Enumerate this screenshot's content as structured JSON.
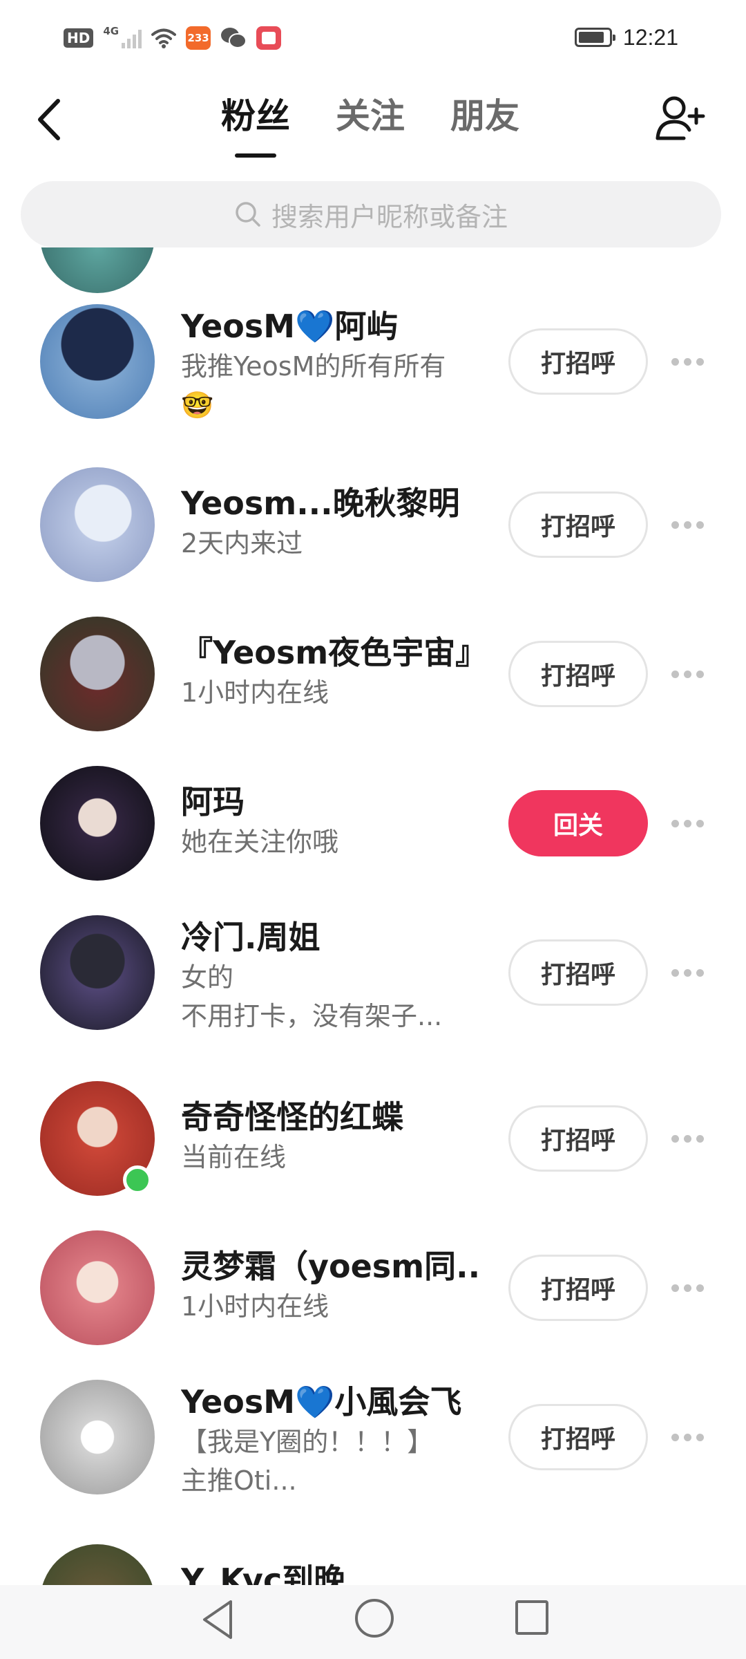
{
  "status_bar": {
    "hd": "HD",
    "network": "4G",
    "app_badge": "233",
    "time": "12:21"
  },
  "header": {
    "tabs": [
      {
        "label": "粉丝",
        "active": true
      },
      {
        "label": "关注",
        "active": false
      },
      {
        "label": "朋友",
        "active": false
      }
    ]
  },
  "search": {
    "placeholder": "搜索用户昵称或备注"
  },
  "contacts": [
    {
      "name": "YeosM💙阿屿",
      "sub": "我推YeosM的所有所有",
      "sub2": "🤓",
      "button": "打招呼",
      "online": false
    },
    {
      "name": "Yeosm...晚秋黎明",
      "sub": "2天内来过",
      "sub2": "",
      "button": "打招呼",
      "online": false
    },
    {
      "name": "『Yeosm夜色宇宙』",
      "sub": "1小时内在线",
      "sub2": "",
      "button": "打招呼",
      "online": false
    },
    {
      "name": "阿玛",
      "sub": "她在关注你哦",
      "sub2": "",
      "button": "回关",
      "online": false
    },
    {
      "name": "冷门.周姐",
      "sub": "女的",
      "sub2": "不用打卡，没有架子...",
      "button": "打招呼",
      "online": false
    },
    {
      "name": "奇奇怪怪的红蝶",
      "sub": "当前在线",
      "sub2": "",
      "button": "打招呼",
      "online": true
    },
    {
      "name": "灵梦霜（yoesm同...",
      "sub": "1小时内在线",
      "sub2": "",
      "button": "打招呼",
      "online": false
    },
    {
      "name": "YeosM💙小風会飞",
      "sub": "【我是Y圈的！！！】",
      "sub2": "主推Oti...",
      "button": "打招呼",
      "online": false
    },
    {
      "name": "Y_Kyc到晚",
      "sub": "",
      "sub2": "",
      "button": "",
      "online": false
    }
  ],
  "colors": {
    "accent": "#f0365e",
    "online": "#3cc654"
  }
}
